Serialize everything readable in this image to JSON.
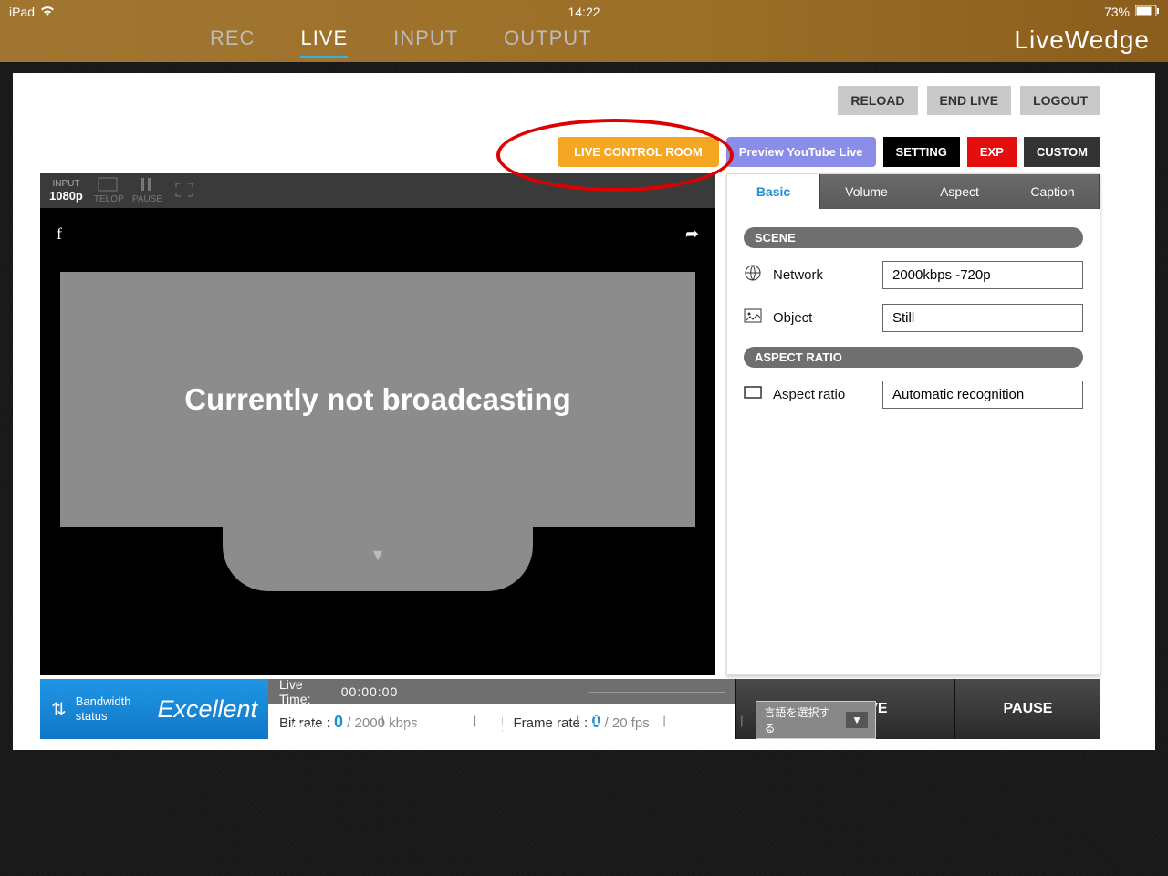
{
  "status_bar": {
    "device": "iPad",
    "time": "14:22",
    "battery": "73%"
  },
  "brand": "LiveWedge",
  "nav": {
    "tabs": [
      "REC",
      "LIVE",
      "INPUT",
      "OUTPUT"
    ],
    "active": "LIVE"
  },
  "top_buttons": {
    "reload": "RELOAD",
    "end_live": "END LIVE",
    "logout": "LOGOUT"
  },
  "mid_buttons": {
    "live_control_room": "LIVE CONTROL ROOM",
    "preview_youtube": "Preview YouTube Live",
    "setting": "SETTING",
    "exp": "EXP",
    "custom": "CUSTOM"
  },
  "input_bar": {
    "label": "INPUT",
    "resolution": "1080p",
    "telop": "TELOP",
    "pause": "PAUSE"
  },
  "preview": {
    "facebook_icon": "f",
    "share_icon": "➦",
    "message": "Currently not broadcasting",
    "tray_arrow": "▼"
  },
  "settings_tabs": [
    "Basic",
    "Volume",
    "Aspect",
    "Caption"
  ],
  "settings_active": "Basic",
  "basic": {
    "scene_header": "SCENE",
    "network_label": "Network",
    "network_value": "2000kbps -720p",
    "object_label": "Object",
    "object_value": "Still",
    "aspect_header": "ASPECT RATIO",
    "aspect_label": "Aspect ratio",
    "aspect_value": "Automatic recognition"
  },
  "bandwidth": {
    "label1": "Bandwidth",
    "label2": "status",
    "value": "Excellent"
  },
  "stats": {
    "live_time_label": "Live Time:",
    "live_time": "00:00:00",
    "bitrate_label": "Bit rate :",
    "bitrate_value": "0",
    "bitrate_max": "/ 2000 kbps",
    "framerate_label": "Frame rate  :",
    "framerate_value": "0",
    "framerate_max": "/ 20 fps"
  },
  "actions": {
    "start": "START LIVE",
    "pause": "PAUSE"
  },
  "footer": {
    "links": [
      "Online Manual",
      "Term of Use",
      "Privacy Policy",
      "Contact Us",
      "About Us"
    ],
    "lang": "言語を選択する"
  }
}
